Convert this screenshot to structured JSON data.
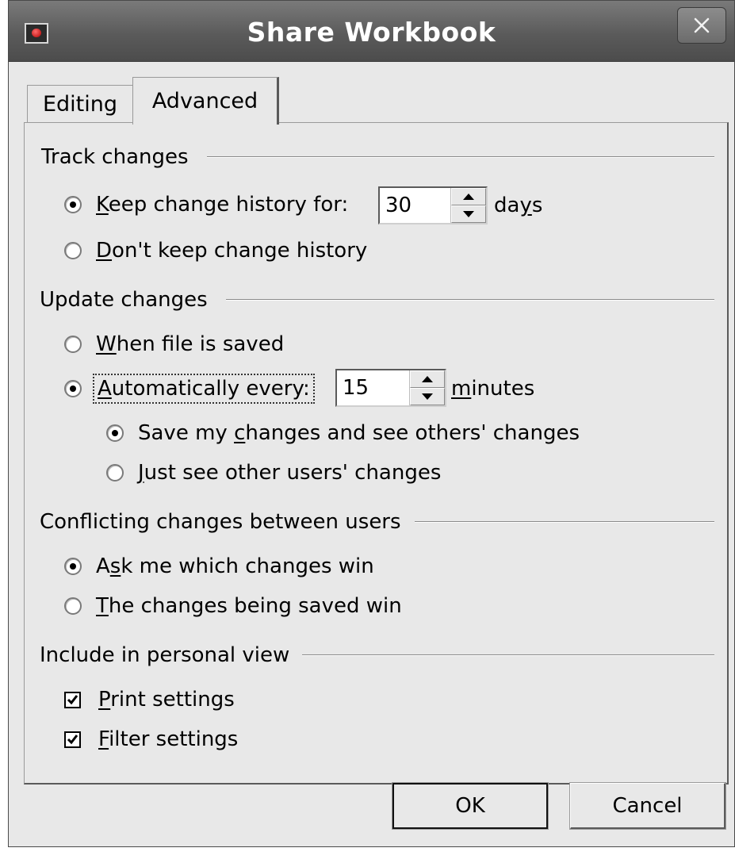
{
  "window": {
    "title": "Share Workbook",
    "icon": "app-icon",
    "close_icon": "close-icon"
  },
  "tabs": [
    {
      "label": "Editing",
      "active": false
    },
    {
      "label": "Advanced",
      "active": true
    }
  ],
  "track_changes": {
    "heading": "Track changes",
    "keep_history": {
      "pre": "",
      "key": "K",
      "post": "eep change history for:",
      "selected": true
    },
    "history_days": "30",
    "days_unit": {
      "pre": "da",
      "key": "y",
      "post": "s"
    },
    "dont_keep": {
      "pre": "",
      "key": "D",
      "post": "on't keep change history",
      "selected": false
    }
  },
  "update_changes": {
    "heading": "Update changes",
    "when_saved": {
      "pre": "",
      "key": "W",
      "post": "hen file is saved",
      "selected": false
    },
    "automatically": {
      "pre": "",
      "key": "A",
      "post": "utomatically every:",
      "selected": true
    },
    "minutes_value": "15",
    "minutes_unit": {
      "pre": "",
      "key": "m",
      "post": "inutes"
    },
    "save_and_see": {
      "pre": "Save my ",
      "key": "c",
      "post": "hanges and see others' changes",
      "selected": true
    },
    "just_see": {
      "pre": "",
      "key": "J",
      "post": "ust see other users' changes",
      "selected": false
    }
  },
  "conflicting": {
    "heading": "Conflicting changes between users",
    "ask_me": {
      "pre": "A",
      "key": "s",
      "post": "k me which changes win",
      "selected": true
    },
    "saved_win": {
      "pre": "",
      "key": "T",
      "post": "he changes being saved win",
      "selected": false
    }
  },
  "personal_view": {
    "heading": "Include in personal view",
    "print_settings": {
      "pre": "",
      "key": "P",
      "post": "rint settings",
      "checked": true
    },
    "filter_settings": {
      "pre": "",
      "key": "F",
      "post": "ilter settings",
      "checked": true
    }
  },
  "buttons": {
    "ok": "OK",
    "cancel": "Cancel"
  }
}
